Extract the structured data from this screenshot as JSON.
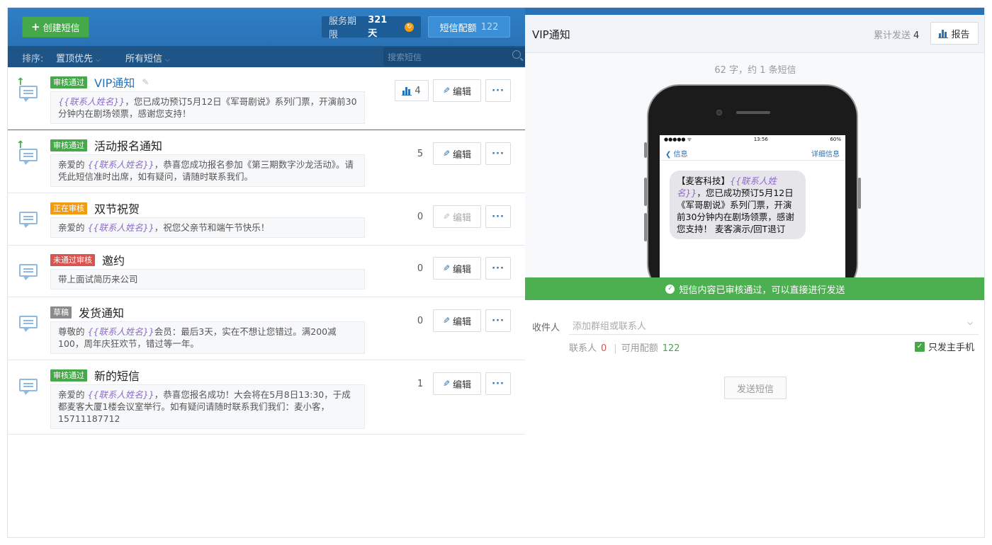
{
  "toolbar": {
    "create_label": "创建短信",
    "service_label": "服务期限",
    "service_days": "321 天",
    "quota_label": "短信配额",
    "quota_value": "122"
  },
  "sortbar": {
    "sort_label": "排序:",
    "sort_option": "置顶优先",
    "filter_option": "所有短信",
    "search_placeholder": "搜索短信"
  },
  "messages": [
    {
      "status": "审核通过",
      "status_type": "ok",
      "title": "VIP通知",
      "pinned": true,
      "var": "{{联系人姓名}}",
      "text": "，您已成功预订5月12日《军哥剧说》系列门票，开演前30分钟内在剧场领票，感谢您支持！",
      "count": "4",
      "edit_label": "编辑",
      "more_label": "···"
    },
    {
      "status": "审核通过",
      "status_type": "ok",
      "title": "活动报名通知",
      "pinned": true,
      "prefix": "亲爱的 ",
      "var": "{{联系人姓名}}",
      "text": "，恭喜您成功报名参加《第三期数字沙龙活动》。请凭此短信准时出席，如有疑问，请随时联系我们。",
      "count": "5",
      "edit_label": "编辑",
      "more_label": "···"
    },
    {
      "status": "正在审核",
      "status_type": "wait",
      "title": "双节祝贺",
      "pinned": false,
      "prefix": "亲爱的 ",
      "var": "{{联系人姓名}}",
      "text": "，祝您父亲节和端午节快乐！",
      "count": "0",
      "edit_label": "编辑",
      "more_label": "···"
    },
    {
      "status": "未通过审核",
      "status_type": "fail",
      "title": "邀约",
      "pinned": false,
      "text": "带上面试简历来公司",
      "count": "0",
      "edit_label": "编辑",
      "more_label": "···"
    },
    {
      "status": "草稿",
      "status_type": "draft",
      "title": "发货通知",
      "pinned": false,
      "prefix": "尊敬的 ",
      "var": "{{联系人姓名}}",
      "text": "会员：最后3天，实在不想让您错过。满200减100，周年庆狂欢节，错过等一年。",
      "count": "0",
      "edit_label": "编辑",
      "more_label": "···"
    },
    {
      "status": "审核通过",
      "status_type": "ok",
      "title": "新的短信",
      "pinned": false,
      "prefix": "亲爱的 ",
      "var": "{{联系人姓名}}",
      "text": "，恭喜您报名成功！大会将在5月8日13:30，于成都麦客大厦1楼会议室举行。如有疑问请随时联系我们我们：麦小客，15711187712",
      "count": "1",
      "edit_label": "编辑",
      "more_label": "···"
    }
  ],
  "detail": {
    "title": "VIP通知",
    "sent_label": "累计发送",
    "sent_count": "4",
    "report_label": "报告",
    "char_count": "62 字，约 1 条短信",
    "phone": {
      "time": "13:56",
      "carrier": "●●●●● ᯤ",
      "battery": "60%",
      "back": "信息",
      "detail": "详细信息",
      "brand": "【麦客科技】",
      "var": "{{联系人姓名}}",
      "text": "，您已成功预订5月12日《军哥剧说》系列门票，开演前30分钟内在剧场领票，感谢您支持！ 麦客演示/回T退订"
    },
    "approved_text": "短信内容已审核通过，可以直接进行发送",
    "recipient_label": "收件人",
    "recipient_placeholder": "添加群组或联系人",
    "contacts_label": "联系人",
    "contacts_count": "0",
    "available_label": "可用配额",
    "available_count": "122",
    "phone_only_label": "只发主手机",
    "send_label": "发送短信"
  }
}
